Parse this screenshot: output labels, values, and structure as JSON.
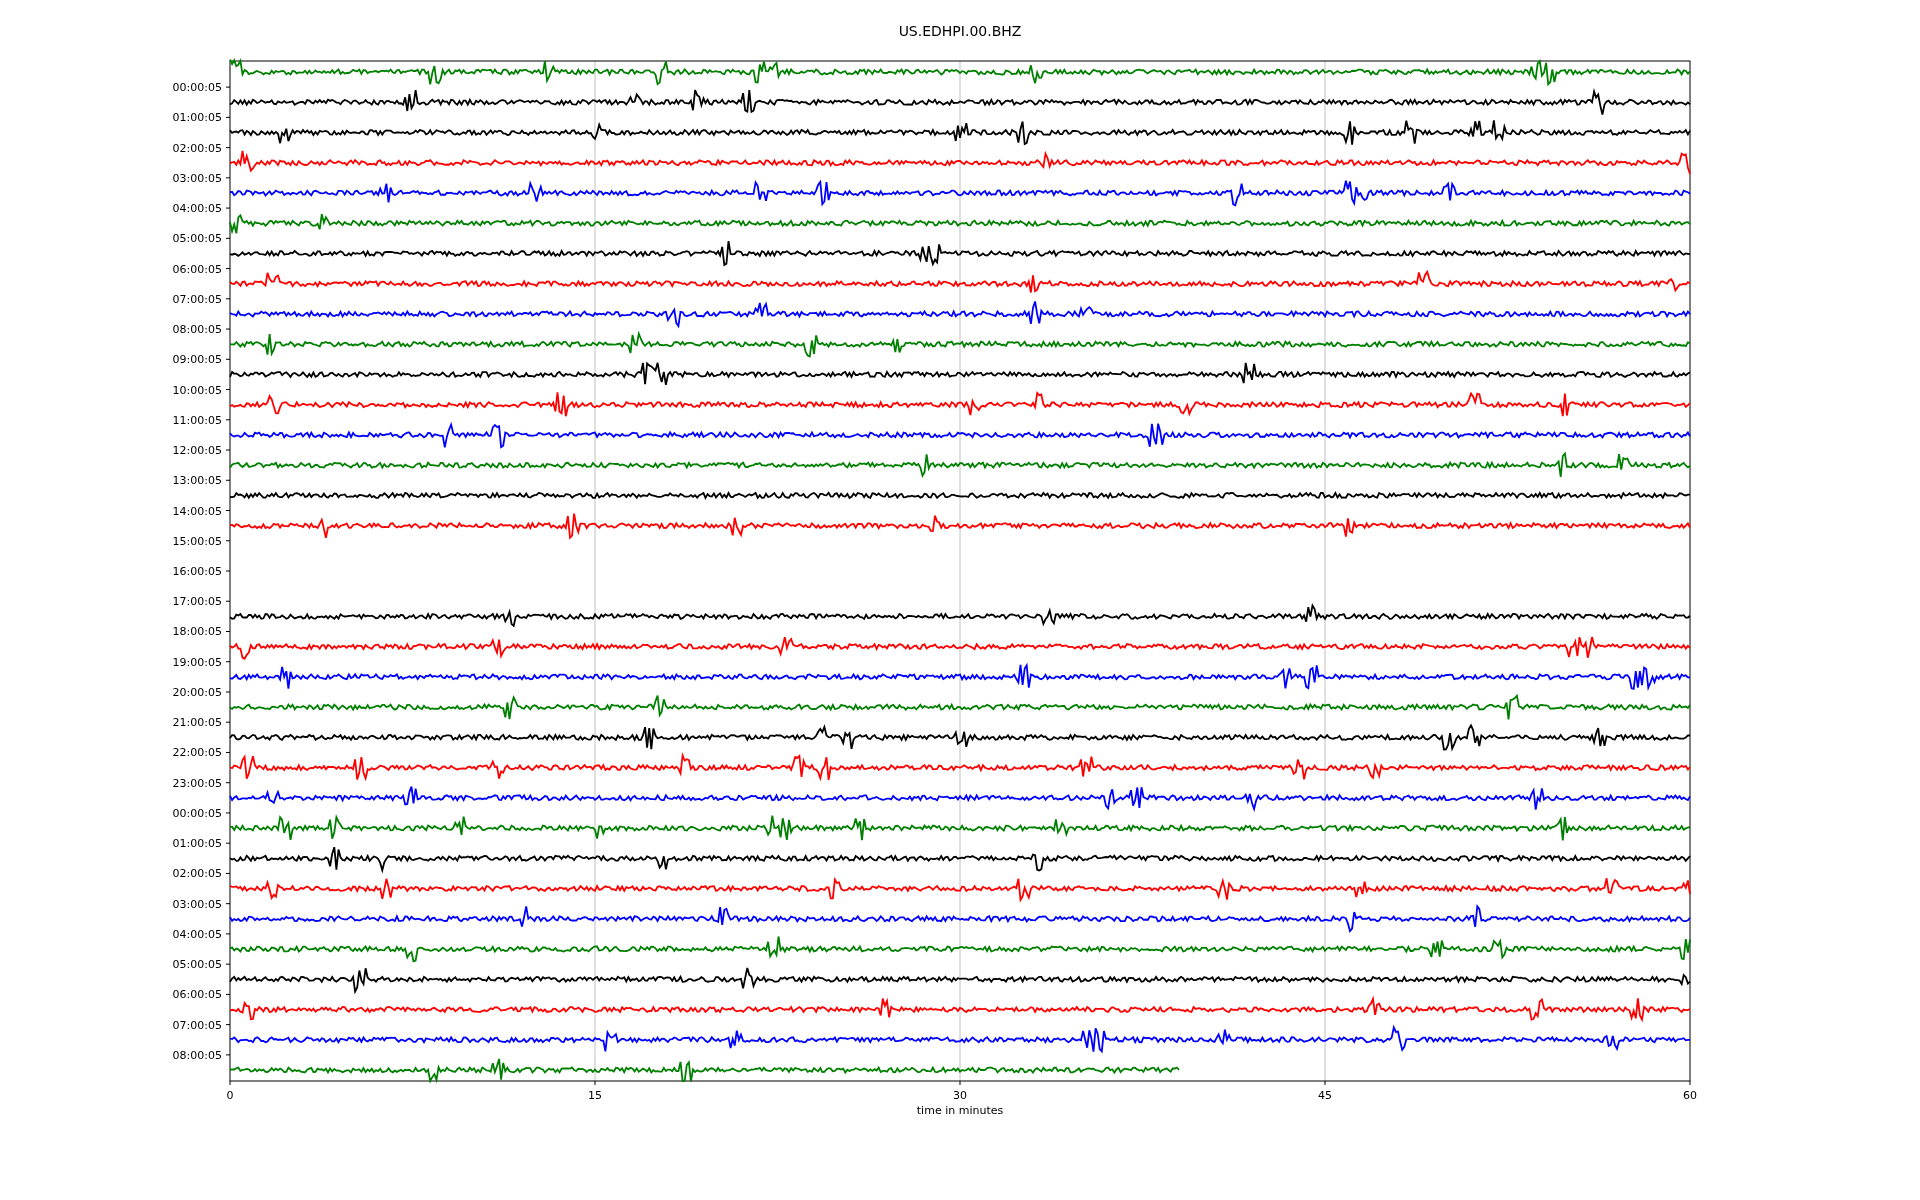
{
  "title": "US.EDHPI.00.BHZ",
  "xlabel": "time in minutes",
  "xticks": [
    "0",
    "15",
    "30",
    "45",
    "60"
  ],
  "ylabels": [
    "00:00:05",
    "01:00:05",
    "02:00:05",
    "03:00:05",
    "04:00:05",
    "05:00:05",
    "06:00:05",
    "07:00:05",
    "08:00:05",
    "09:00:05",
    "10:00:05",
    "11:00:05",
    "12:00:05",
    "13:00:05",
    "14:00:05",
    "15:00:05",
    "16:00:05",
    "17:00:05",
    "18:00:05",
    "19:00:05",
    "20:00:05",
    "21:00:05",
    "22:00:05",
    "23:00:05",
    "00:00:05",
    "01:00:05",
    "02:00:05",
    "03:00:05",
    "04:00:05",
    "05:00:05",
    "06:00:05",
    "07:00:05",
    "08:00:05"
  ],
  "traces": [
    {
      "color": "#008000",
      "level": 1
    },
    {
      "color": "#000000",
      "level": 1
    },
    {
      "color": "#000000",
      "level": 1
    },
    {
      "color": "#ff0000",
      "level": 1
    },
    {
      "color": "#0000ff",
      "level": 1
    },
    {
      "color": "#008000",
      "level": 1
    },
    {
      "color": "#000000",
      "level": 1
    },
    {
      "color": "#ff0000",
      "level": 1
    },
    {
      "color": "#0000ff",
      "level": 1
    },
    {
      "color": "#008000",
      "level": 1
    },
    {
      "color": "#000000",
      "level": 1
    },
    {
      "color": "#ff0000",
      "level": 1
    },
    {
      "color": "#0000ff",
      "level": 1
    },
    {
      "color": "#008000",
      "level": 1
    },
    {
      "color": "#000000",
      "level": 1
    },
    {
      "color": "#ff0000",
      "level": 1
    },
    {
      "kind": "gap"
    },
    {
      "kind": "gap"
    },
    {
      "color": "#000000",
      "level": 1
    },
    {
      "color": "#ff0000",
      "level": 1
    },
    {
      "color": "#0000ff",
      "level": 1
    },
    {
      "color": "#008000",
      "level": 1
    },
    {
      "color": "#000000",
      "level": 1
    },
    {
      "color": "#ff0000",
      "level": 1
    },
    {
      "color": "#0000ff",
      "level": 1
    },
    {
      "color": "#008000",
      "level": 1
    },
    {
      "color": "#000000",
      "level": 1
    },
    {
      "color": "#ff0000",
      "level": 1
    },
    {
      "color": "#0000ff",
      "level": 1
    },
    {
      "color": "#008000",
      "level": 1
    },
    {
      "color": "#000000",
      "level": 1
    },
    {
      "color": "#ff0000",
      "level": 1
    },
    {
      "color": "#0000ff",
      "level": 1
    },
    {
      "color": "#008000",
      "level": 0.65
    }
  ]
}
